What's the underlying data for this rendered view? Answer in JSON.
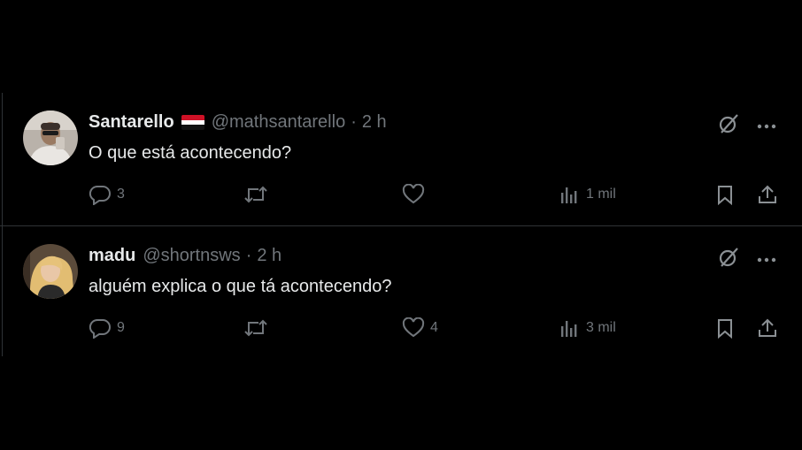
{
  "tweets": [
    {
      "name": "Santarello",
      "has_flag": true,
      "handle": "@mathsantarello",
      "dot": "·",
      "time": "2 h",
      "text": "O que está acontecendo?",
      "replies": "3",
      "retweets": "",
      "likes": "",
      "views": "1 mil"
    },
    {
      "name": "madu",
      "has_flag": false,
      "handle": "@shortnsws",
      "dot": "·",
      "time": "2 h",
      "text": "alguém explica o que tá acontecendo?",
      "replies": "9",
      "retweets": "",
      "likes": "4",
      "views": "3 mil"
    }
  ],
  "icons": {
    "top": [
      "grok-icon",
      "more-icon"
    ],
    "actions": [
      "reply-icon",
      "retweet-icon",
      "like-icon",
      "views-icon",
      "bookmark-icon",
      "share-icon"
    ]
  },
  "colors": {
    "background": "#000000",
    "text": "#e7e9ea",
    "secondary": "#71767b",
    "divider": "#2f3336"
  }
}
